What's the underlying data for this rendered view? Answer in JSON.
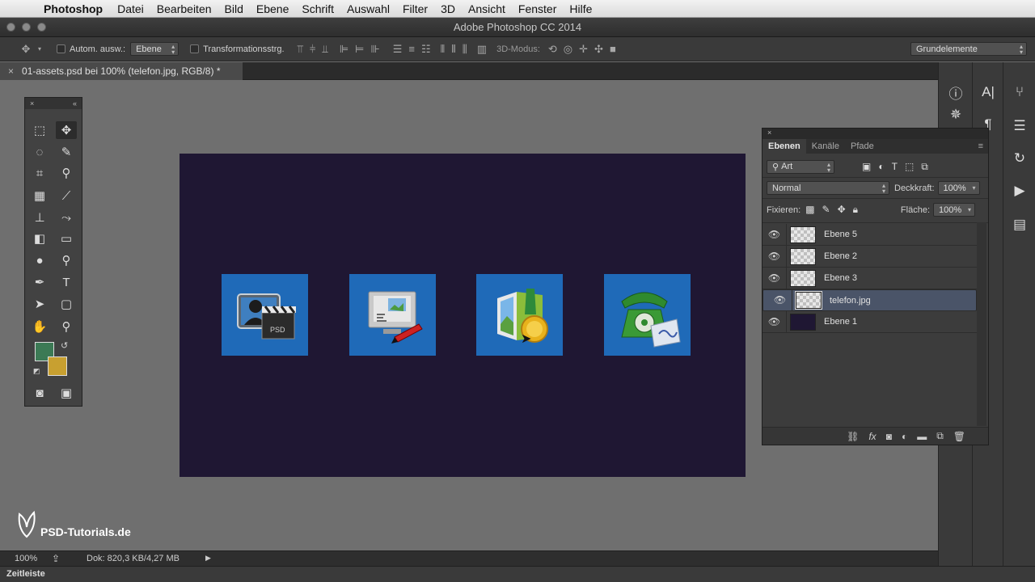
{
  "menubar": {
    "app_name": "Photoshop",
    "items": [
      "Datei",
      "Bearbeiten",
      "Bild",
      "Ebene",
      "Schrift",
      "Auswahl",
      "Filter",
      "3D",
      "Ansicht",
      "Fenster",
      "Hilfe"
    ]
  },
  "window": {
    "title": "Adobe Photoshop CC 2014"
  },
  "options_bar": {
    "auto_select_label": "Autom. ausw.:",
    "auto_select_value": "Ebene",
    "transform_label": "Transformationsstrg.",
    "mode_3d_label": "3D-Modus:",
    "workspace": "Grundelemente"
  },
  "document": {
    "tab_title": "01-assets.psd bei 100% (telefon.jpg, RGB/8) *"
  },
  "canvas": {
    "background": "#1f1733",
    "tile_color": "#1f6ab8",
    "assets": [
      "clapper-portrait-icon",
      "monitor-pen-icon",
      "frame-medal-icon",
      "telephone-icon"
    ]
  },
  "layers_panel": {
    "tabs": [
      "Ebenen",
      "Kanäle",
      "Pfade"
    ],
    "filter_label": "Art",
    "blend_mode": "Normal",
    "opacity_label": "Deckkraft:",
    "opacity_value": "100%",
    "lock_label": "Fixieren:",
    "fill_label": "Fläche:",
    "fill_value": "100%",
    "layers": [
      {
        "name": "Ebene 5",
        "selected": false
      },
      {
        "name": "Ebene 2",
        "selected": false
      },
      {
        "name": "Ebene 3",
        "selected": false
      },
      {
        "name": "telefon.jpg",
        "selected": true
      },
      {
        "name": "Ebene 1",
        "selected": false
      }
    ]
  },
  "status_bar": {
    "zoom": "100%",
    "doc_info": "Dok: 820,3 KB/4,27 MB"
  },
  "timeline": {
    "label": "Zeitleiste"
  },
  "watermark": {
    "text": "PSD-Tutorials.de"
  },
  "colors": {
    "foreground": "#3c7a55",
    "background": "#c8a030",
    "selection": "#4a5468"
  }
}
